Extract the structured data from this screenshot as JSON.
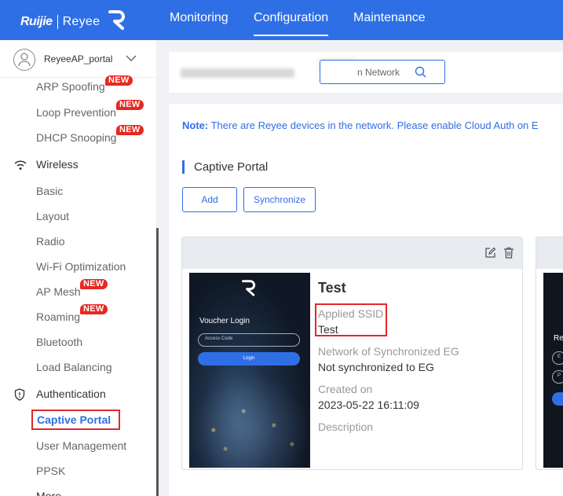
{
  "brand": {
    "ruijie": "Ruijie",
    "reyee": "Reyee"
  },
  "nav": {
    "monitoring": "Monitoring",
    "configuration": "Configuration",
    "maintenance": "Maintenance",
    "active": "Configuration"
  },
  "user": {
    "name": "ReyeeAP_portal"
  },
  "sidebar": {
    "items": {
      "arp_spoofing": "ARP Spoofing",
      "loop_prevention": "Loop Prevention",
      "dhcp_snooping": "DHCP Snooping",
      "wireless": "Wireless",
      "basic": "Basic",
      "layout": "Layout",
      "radio": "Radio",
      "wifi_optimization": "Wi-Fi Optimization",
      "ap_mesh": "AP Mesh",
      "roaming": "Roaming",
      "bluetooth": "Bluetooth",
      "load_balancing": "Load Balancing",
      "authentication": "Authentication",
      "captive_portal": "Captive Portal",
      "user_management": "User Management",
      "ppsk": "PPSK",
      "more": "More"
    },
    "badge": "NEW"
  },
  "search": {
    "text": "n Network"
  },
  "note": {
    "label": "Note:",
    "text": " There are Reyee devices in the network. Please enable Cloud Auth on E"
  },
  "section": {
    "title": "Captive Portal"
  },
  "buttons": {
    "add": "Add",
    "synchronize": "Synchronize"
  },
  "portal": {
    "name": "Test",
    "applied_ssid_label": "Applied SSID",
    "applied_ssid_value": "Test",
    "network_label": "Network of Synchronized EG",
    "network_value": "Not synchronized to EG",
    "created_label": "Created on",
    "created_value": "2023-05-22 16:11:09",
    "description_label": "Description",
    "preview": {
      "title": "Voucher Login",
      "placeholder": "Access Code",
      "button": "Login"
    }
  },
  "second_preview": {
    "title": "Re",
    "field1": "E",
    "field2": "P"
  },
  "colors": {
    "accent": "#2f6fe6",
    "badge": "#e8281e",
    "highlight": "#e0282a"
  }
}
